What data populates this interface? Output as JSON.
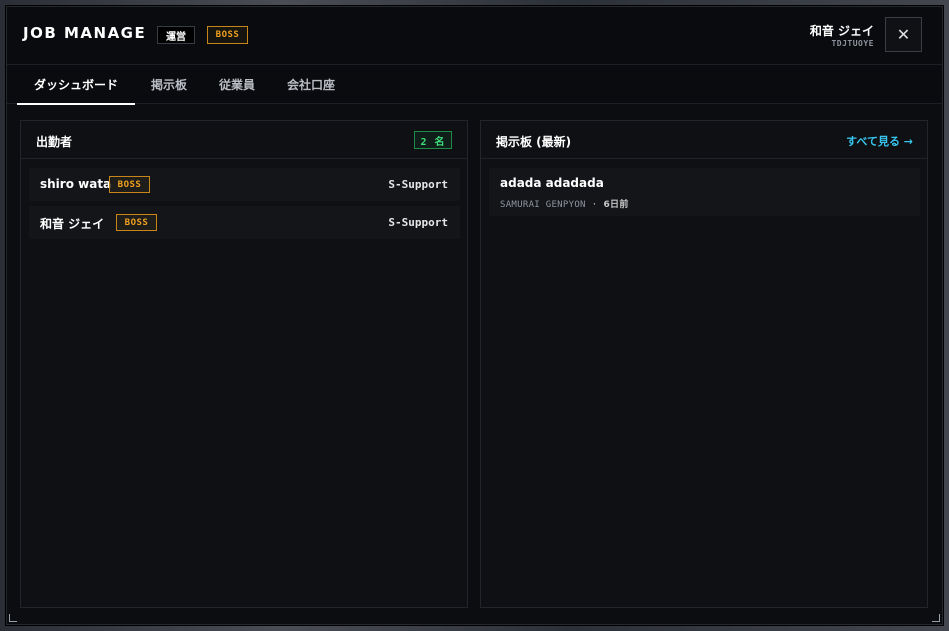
{
  "header": {
    "title": "JOB MANAGE",
    "role_badge": "運営",
    "boss_badge": "BOSS",
    "user_name": "和音 ジェイ",
    "user_id": "TDJTUOYE",
    "close_label": "✕"
  },
  "tabs": [
    {
      "label": "ダッシュボード",
      "active": true
    },
    {
      "label": "掲示板",
      "active": false
    },
    {
      "label": "従業員",
      "active": false
    },
    {
      "label": "会社口座",
      "active": false
    }
  ],
  "attendance": {
    "title": "出勤者",
    "count_label": "2 名",
    "rows": [
      {
        "name": "shiro wata",
        "badge": "BOSS",
        "job": "S-Support"
      },
      {
        "name": "和音 ジェイ",
        "badge": "BOSS",
        "job": "S-Support"
      }
    ]
  },
  "board": {
    "title": "掲示板 (最新)",
    "see_all": "すべて見る →",
    "posts": [
      {
        "title": "adada adadada",
        "author": "SAMURAI GENPYON",
        "separator": "·",
        "ago": "6日前"
      }
    ]
  },
  "colors": {
    "accent_boss": "#f0a21f",
    "accent_count": "#3ddc7a",
    "accent_link": "#38c6f0",
    "background": "#0b0d11"
  }
}
